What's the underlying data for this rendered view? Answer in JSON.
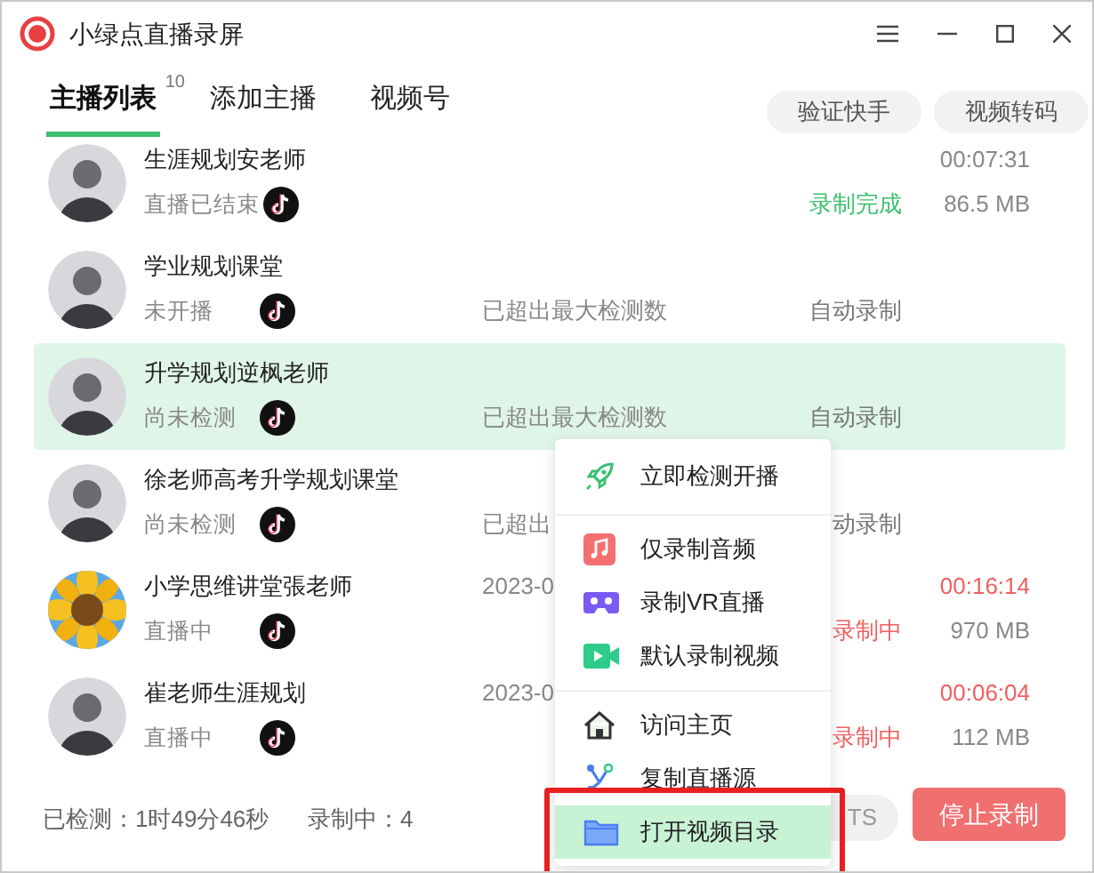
{
  "window": {
    "title": "小绿点直播录屏"
  },
  "tabs": [
    {
      "label": "主播列表",
      "selected": true,
      "count": "10"
    },
    {
      "label": "添加主播",
      "selected": false
    },
    {
      "label": "视频号",
      "selected": false
    }
  ],
  "header_buttons": [
    "验证快手",
    "视频转码"
  ],
  "streamers": [
    {
      "kind": "done",
      "name": "生涯规划安老师",
      "state": "直播已结束",
      "selected": false,
      "mode": "录制完成",
      "duration": "00:07:31",
      "size": "86.5 MB"
    },
    {
      "kind": "auto",
      "name": "学业规划课堂",
      "state": "未开播",
      "selected": false,
      "note": "已超出最大检测数",
      "mode": "自动录制"
    },
    {
      "kind": "auto",
      "name": "升学规划逆枫老师",
      "state": "尚未检测",
      "selected": true,
      "note": "已超出最大检测数",
      "mode": "自动录制"
    },
    {
      "kind": "auto",
      "name": "徐老师高考升学规划课堂",
      "state": "尚未检测",
      "selected": false,
      "note": "已超出",
      "mode": "动录制"
    },
    {
      "kind": "recording",
      "name": "小学思维讲堂張老师",
      "state": "直播中",
      "selected": false,
      "started": "2023-0",
      "mode": "录制中",
      "duration": "00:16:14",
      "size": "970 MB"
    },
    {
      "kind": "recording",
      "name": "崔老师生涯规划",
      "state": "直播中",
      "selected": false,
      "started": "2023-0",
      "mode": "录制中",
      "duration": "00:06:04",
      "size": "112 MB"
    }
  ],
  "context_menu": {
    "groups": [
      [
        {
          "kind": "rocket",
          "label": "立即检测开播",
          "selected": false,
          "framed": false
        }
      ],
      [
        {
          "kind": "music",
          "label": "仅录制音频",
          "selected": false,
          "framed": false
        },
        {
          "kind": "vr",
          "label": "录制VR直播",
          "selected": false,
          "framed": false
        },
        {
          "kind": "video",
          "label": "默认录制视频",
          "selected": false,
          "framed": false
        }
      ],
      [
        {
          "kind": "home",
          "label": "访问主页",
          "selected": false,
          "framed": false
        },
        {
          "kind": "share",
          "label": "复制直播源",
          "selected": false,
          "framed": false
        },
        {
          "kind": "folder",
          "label": "打开视频目录",
          "selected": true,
          "framed": true
        }
      ]
    ]
  },
  "footer": {
    "checked": "已检测：1时49分46秒",
    "recording": "录制中：4",
    "ts_button": "TS",
    "stop_button": "停止录制"
  }
}
